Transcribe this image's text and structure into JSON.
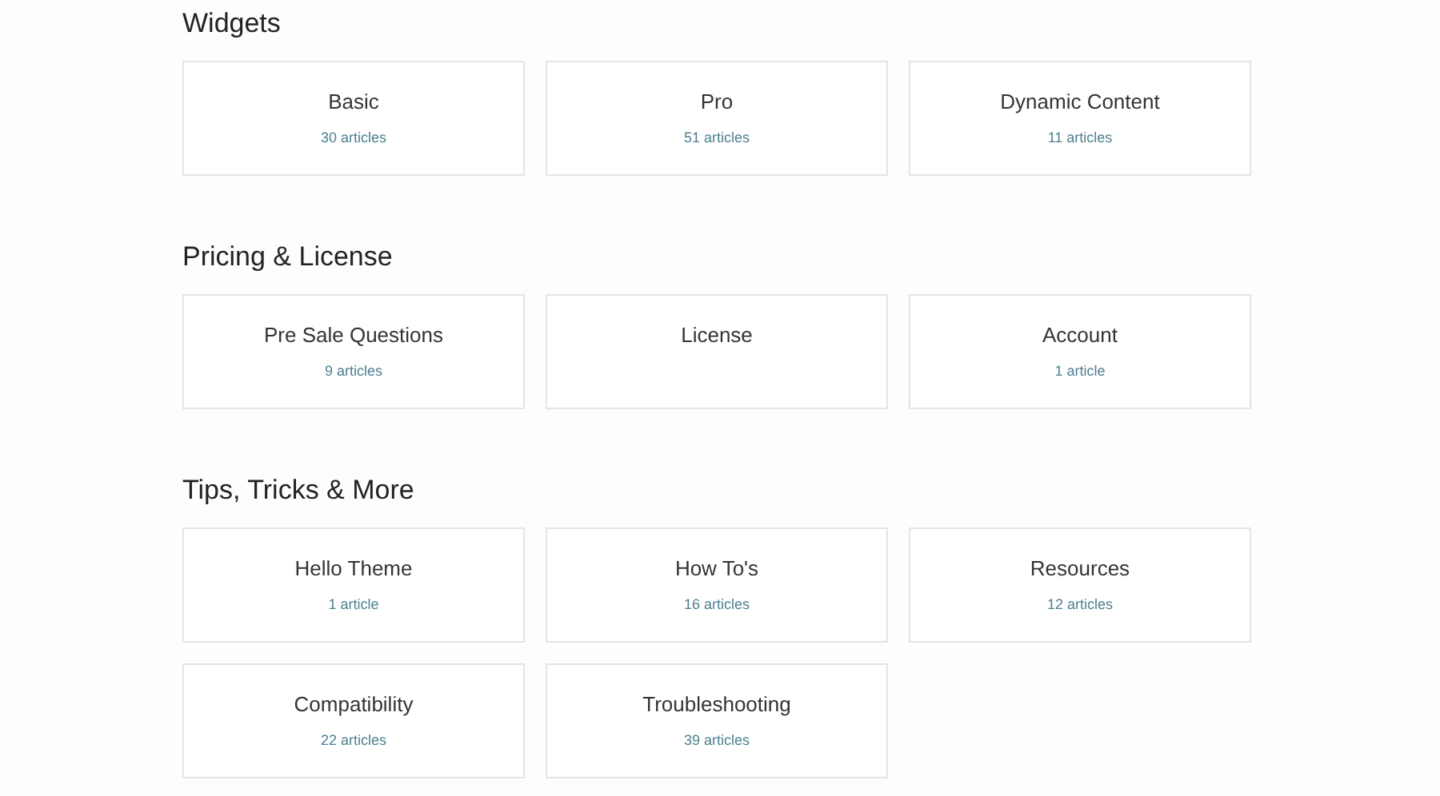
{
  "sections": [
    {
      "title": "Widgets",
      "categories": [
        {
          "name": "Basic",
          "count": "30 articles"
        },
        {
          "name": "Pro",
          "count": "51 articles"
        },
        {
          "name": "Dynamic Content",
          "count": "11 articles"
        }
      ]
    },
    {
      "title": "Pricing & License",
      "categories": [
        {
          "name": "Pre Sale Questions",
          "count": "9 articles"
        },
        {
          "name": "License"
        },
        {
          "name": "Account",
          "count": "1 article"
        }
      ]
    },
    {
      "title": "Tips, Tricks & More",
      "categories": [
        {
          "name": "Hello Theme",
          "count": "1 article"
        },
        {
          "name": "How To's",
          "count": "16 articles"
        },
        {
          "name": "Resources",
          "count": "12 articles"
        },
        {
          "name": "Compatibility",
          "count": "22 articles"
        },
        {
          "name": "Troubleshooting",
          "count": "39 articles"
        }
      ]
    }
  ]
}
